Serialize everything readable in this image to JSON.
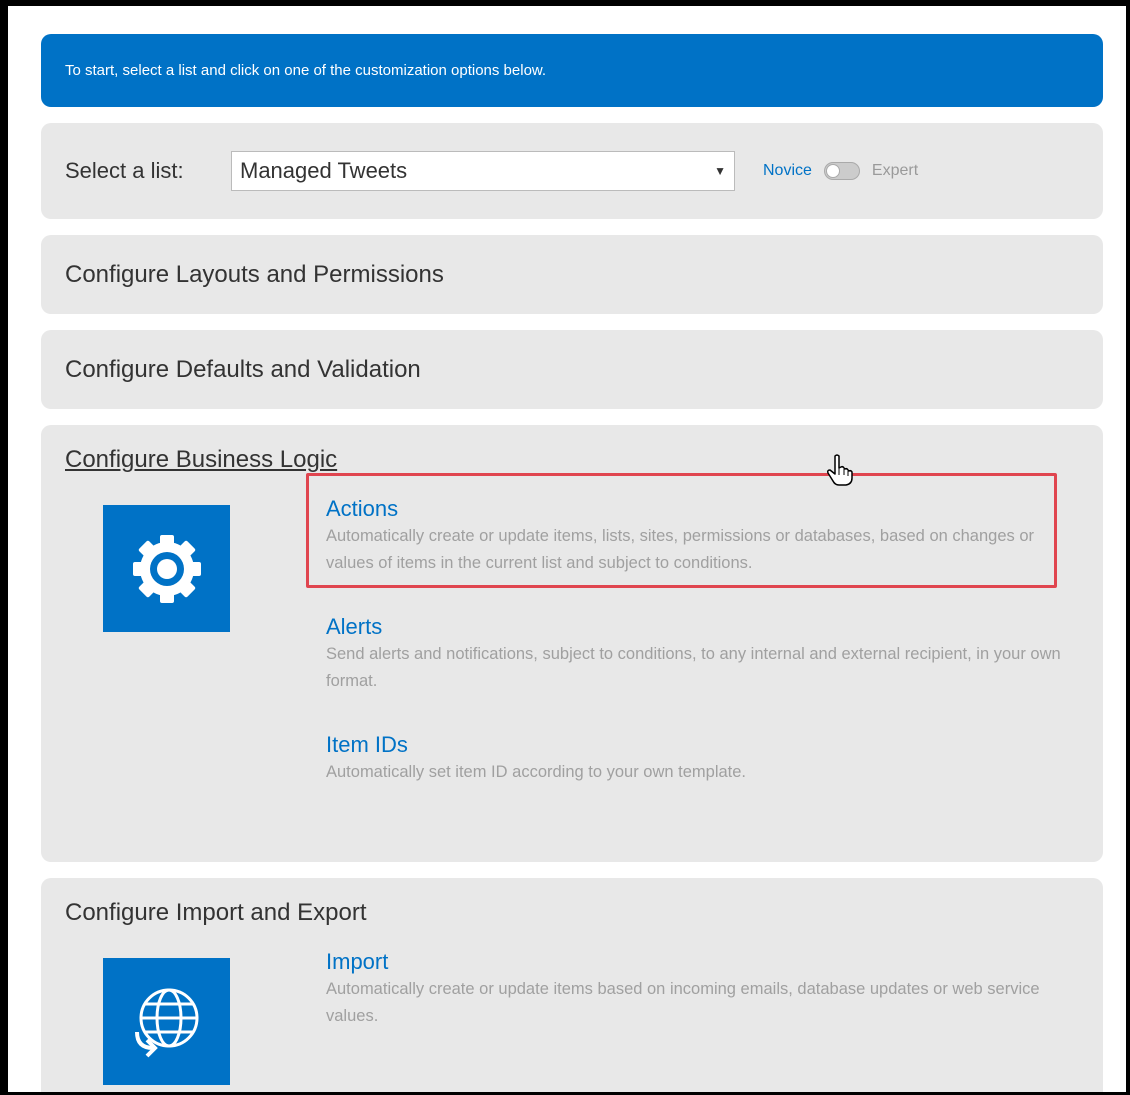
{
  "banner": {
    "text": "To start, select a list and click on one of the customization options below."
  },
  "list_selector": {
    "label": "Select a list:",
    "selected": "Managed Tweets",
    "mode_novice": "Novice",
    "mode_expert": "Expert"
  },
  "sections": {
    "layouts": "Configure Layouts and Permissions",
    "defaults": "Configure Defaults and Validation",
    "business_logic": "Configure Business Logic",
    "import_export": "Configure Import and Export"
  },
  "business_logic": {
    "icon": "gear-icon",
    "features": [
      {
        "title": "Actions",
        "desc": "Automatically create or update items, lists, sites, permissions or databases, based on changes or values of items in the current list and subject to conditions."
      },
      {
        "title": "Alerts",
        "desc": "Send alerts and notifications, subject to conditions, to any internal and external recipient, in your own format."
      },
      {
        "title": "Item IDs",
        "desc": "Automatically set item ID according to your own template."
      }
    ]
  },
  "import_export": {
    "icon": "globe-icon",
    "features": [
      {
        "title": "Import",
        "desc": "Automatically create or update items based on incoming emails, database updates or web service values."
      }
    ]
  },
  "colors": {
    "accent": "#0072c6",
    "panel": "#e8e8e8",
    "highlight": "#e0454f"
  }
}
